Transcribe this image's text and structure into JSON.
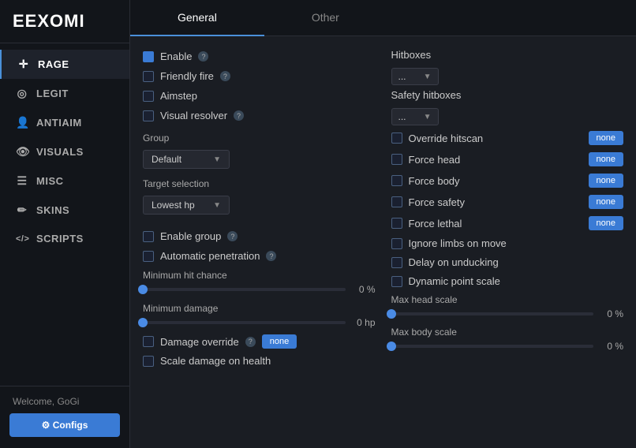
{
  "sidebar": {
    "logo": "EEXOMI",
    "items": [
      {
        "id": "rage",
        "label": "RAGE",
        "icon": "✛",
        "active": true
      },
      {
        "id": "legit",
        "label": "LEGIT",
        "icon": "◎"
      },
      {
        "id": "antiaim",
        "label": "ANTIAIM",
        "icon": "👤"
      },
      {
        "id": "visuals",
        "label": "VISUALS",
        "icon": "👁"
      },
      {
        "id": "misc",
        "label": "MISC",
        "icon": "≡"
      },
      {
        "id": "skins",
        "label": "SKINS",
        "icon": "✏"
      },
      {
        "id": "scripts",
        "label": "SCRIPTS",
        "icon": "</>"
      }
    ],
    "footer": {
      "welcome": "Welcome, GoGi",
      "configs_label": "⚙ Configs"
    }
  },
  "tabs": [
    {
      "id": "general",
      "label": "General",
      "active": true
    },
    {
      "id": "other",
      "label": "Other",
      "active": false
    }
  ],
  "left": {
    "checkboxes": [
      {
        "id": "enable",
        "label": "Enable",
        "checked": true,
        "has_help": true
      },
      {
        "id": "friendly-fire",
        "label": "Friendly fire",
        "checked": false,
        "has_help": true
      },
      {
        "id": "aimstep",
        "label": "Aimstep",
        "checked": false,
        "has_help": false
      },
      {
        "id": "visual-resolver",
        "label": "Visual resolver",
        "checked": false,
        "has_help": true
      }
    ],
    "group_label": "Group",
    "group_value": "Default",
    "target_selection_label": "Target selection",
    "target_value": "Lowest hp",
    "checkboxes2": [
      {
        "id": "enable-group",
        "label": "Enable group",
        "checked": false,
        "has_help": true
      },
      {
        "id": "auto-penetration",
        "label": "Automatic penetration",
        "checked": false,
        "has_help": true
      }
    ],
    "min_hit_chance_label": "Minimum hit chance",
    "min_hit_chance_value": "0 %",
    "min_hit_chance_pct": 0,
    "min_damage_label": "Minimum damage",
    "min_damage_value": "0 hp",
    "min_damage_pct": 0,
    "damage_override_label": "Damage override",
    "damage_override_btn": "none",
    "scale_damage_label": "Scale damage on health",
    "has_help_dmg": true
  },
  "right": {
    "hitboxes_label": "Hitboxes",
    "hitboxes_dropdown": "...",
    "safety_hitboxes_label": "Safety hitboxes",
    "safety_dropdown": "...",
    "items": [
      {
        "id": "override-hitscan",
        "label": "Override hitscan",
        "checked": false,
        "has_btn": true,
        "btn_label": "none"
      },
      {
        "id": "force-head",
        "label": "Force head",
        "checked": false,
        "has_btn": true,
        "btn_label": "none"
      },
      {
        "id": "force-body",
        "label": "Force body",
        "checked": false,
        "has_btn": true,
        "btn_label": "none"
      },
      {
        "id": "force-safety",
        "label": "Force safety",
        "checked": false,
        "has_btn": true,
        "btn_label": "none"
      },
      {
        "id": "force-lethal",
        "label": "Force lethal",
        "checked": false,
        "has_btn": true,
        "btn_label": "none"
      },
      {
        "id": "ignore-limbs",
        "label": "Ignore limbs on move",
        "checked": false,
        "has_btn": false
      },
      {
        "id": "delay-unducking",
        "label": "Delay on unducking",
        "checked": false,
        "has_btn": false
      },
      {
        "id": "dynamic-point",
        "label": "Dynamic point scale",
        "checked": false,
        "has_btn": false
      }
    ],
    "max_head_scale_label": "Max head scale",
    "max_head_scale_value": "0 %",
    "max_head_pct": 0,
    "max_body_scale_label": "Max body scale",
    "max_body_scale_value": "0 %",
    "max_body_pct": 0
  }
}
